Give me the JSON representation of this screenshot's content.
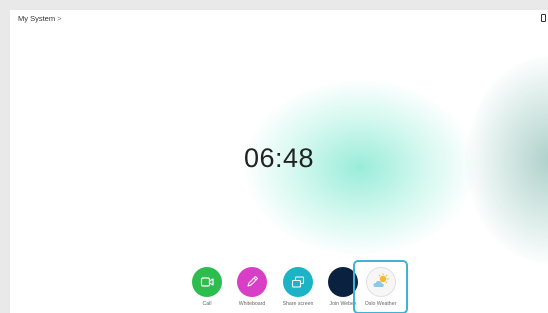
{
  "header": {
    "title": "My System",
    "chevron": ">"
  },
  "clock": {
    "time": "06:48"
  },
  "dock": {
    "items": [
      {
        "id": "call",
        "label": "Call",
        "icon": "video-camera-icon",
        "color": "#2dbd4f"
      },
      {
        "id": "whiteboard",
        "label": "Whiteboard",
        "icon": "pencil-icon",
        "color": "#d93fc6"
      },
      {
        "id": "share",
        "label": "Share screen",
        "icon": "share-screen-icon",
        "color": "#1db3c6"
      },
      {
        "id": "webex",
        "label": "Join Webex",
        "icon": "webex-logo-icon",
        "color": "#0a2240"
      },
      {
        "id": "weather",
        "label": "Oslo Weather",
        "icon": "partly-cloudy-icon",
        "color": "#f6f6f6",
        "selected": true
      }
    ]
  },
  "colors": {
    "accent_selected": "#3fb3d6",
    "glow": "#78e6cd"
  }
}
